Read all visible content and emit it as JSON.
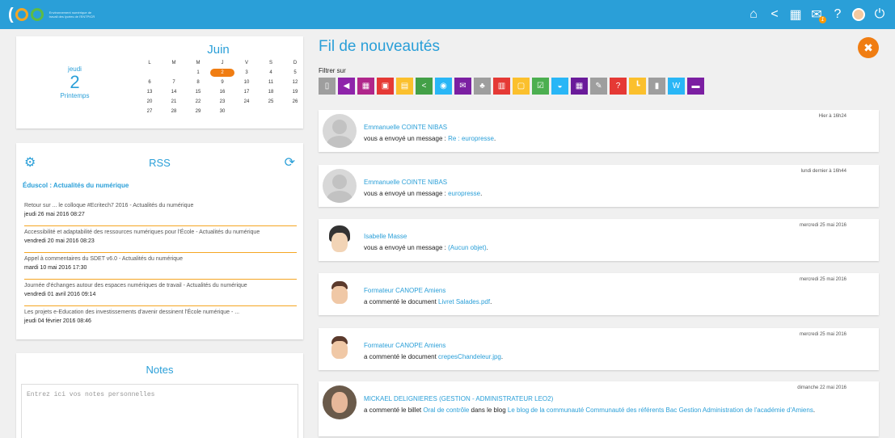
{
  "header": {
    "logo_text": "eo",
    "logo_tagline": "Environnement numérique de travail des lycées de l'ENTPICR",
    "icons": [
      "home-icon",
      "share-icon",
      "apps-icon",
      "messages-icon",
      "help-icon",
      "profile-avatar",
      "power-icon"
    ],
    "messages_badge": "1"
  },
  "calendar": {
    "weekday": "jeudi",
    "day": "2",
    "season": "Printemps",
    "month": "Juin",
    "headers": [
      "L",
      "M",
      "M",
      "J",
      "V",
      "S",
      "D"
    ],
    "days": [
      "",
      "",
      "1",
      "2",
      "3",
      "4",
      "5",
      "6",
      "7",
      "8",
      "9",
      "10",
      "11",
      "12",
      "13",
      "14",
      "15",
      "16",
      "17",
      "18",
      "19",
      "20",
      "21",
      "22",
      "23",
      "24",
      "25",
      "26",
      "27",
      "28",
      "29",
      "30"
    ],
    "today": "2"
  },
  "rss": {
    "title": "RSS",
    "source": "Éduscol : Actualités du numérique",
    "items": [
      {
        "title": "Retour sur ... le colloque #Ecritech7 2016 - Actualités du numérique",
        "date": "jeudi 26 mai 2016 08:27"
      },
      {
        "title": "Accessibilité et adaptabilité des ressources numériques pour l'École - Actualités du numérique",
        "date": "vendredi 20 mai 2016 08:23"
      },
      {
        "title": "Appel à commentaires du SDET v6.0 - Actualités du numérique",
        "date": "mardi 10 mai 2016 17:30"
      },
      {
        "title": "Journée d'échanges autour des espaces numériques de travail - Actualités du numérique",
        "date": "vendredi 01 avril 2016 09:14"
      },
      {
        "title": "Les projets e-Education des investissements d'avenir dessinent l'École numérique - ...",
        "date": "jeudi 04 février 2016 08:46"
      }
    ]
  },
  "notes": {
    "title": "Notes",
    "placeholder": "Entrez ici vos notes personnelles"
  },
  "feed": {
    "title": "Fil de nouveautés",
    "filter_label": "Filtrer sur",
    "filters": [
      {
        "name": "document-filter",
        "color": "#9e9e9e",
        "glyph": "▯"
      },
      {
        "name": "announce-filter",
        "color": "#8e24aa",
        "glyph": "◀"
      },
      {
        "name": "calendar-filter",
        "color": "#b0268b",
        "glyph": "▦"
      },
      {
        "name": "gift-filter",
        "color": "#e53935",
        "glyph": "▣"
      },
      {
        "name": "print-filter",
        "color": "#fbc02d",
        "glyph": "▤"
      },
      {
        "name": "share-filter",
        "color": "#43a047",
        "glyph": "<"
      },
      {
        "name": "chat-filter",
        "color": "#29b6f6",
        "glyph": "◉"
      },
      {
        "name": "mail-filter",
        "color": "#7b1fa2",
        "glyph": "✉"
      },
      {
        "name": "network-filter",
        "color": "#9e9e9e",
        "glyph": "♣"
      },
      {
        "name": "news-filter",
        "color": "#e53935",
        "glyph": "▥"
      },
      {
        "name": "board-filter",
        "color": "#fbc02d",
        "glyph": "▢"
      },
      {
        "name": "check-filter",
        "color": "#4caf50",
        "glyph": "☑"
      },
      {
        "name": "inbox-filter",
        "color": "#29b6f6",
        "glyph": "◒"
      },
      {
        "name": "schedule-filter",
        "color": "#6a1b9a",
        "glyph": "▦"
      },
      {
        "name": "pen-filter",
        "color": "#9e9e9e",
        "glyph": "✎"
      },
      {
        "name": "help-filter",
        "color": "#e53935",
        "glyph": "?"
      },
      {
        "name": "tree-filter",
        "color": "#fbc02d",
        "glyph": "┗"
      },
      {
        "name": "user-filter",
        "color": "#9e9e9e",
        "glyph": "▮"
      },
      {
        "name": "wiki-filter",
        "color": "#29b6f6",
        "glyph": "W"
      },
      {
        "name": "folder-filter",
        "color": "#7b1fa2",
        "glyph": "▬"
      }
    ],
    "posts": [
      {
        "avatar": "g",
        "date": "Hier à 16h24",
        "name": "Emmanuelle COINTE NIBAS",
        "text": "vous a envoyé un message : ",
        "link": "Re : europresse",
        "suffix": "."
      },
      {
        "avatar": "g",
        "date": "lundi dernier à 16h44",
        "name": "Emmanuelle COINTE NIBAS",
        "text": "vous a envoyé un message : ",
        "link": "europresse",
        "suffix": "."
      },
      {
        "avatar": "f",
        "date": "mercredi 25 mai 2016",
        "name": "Isabelle Masse",
        "text": "vous a envoyé un message : ",
        "link": "(Aucun objet)",
        "suffix": "."
      },
      {
        "avatar": "m",
        "date": "mercredi 25 mai 2016",
        "name": "Formateur CANOPE Amiens",
        "text": "a commenté le document ",
        "link": "Livret Salades.pdf",
        "suffix": "."
      },
      {
        "avatar": "m",
        "date": "mercredi 25 mai 2016",
        "name": "Formateur CANOPE Amiens",
        "text": "a commenté le document ",
        "link": "crepesChandeleur.jpg",
        "suffix": "."
      },
      {
        "avatar": "p",
        "date": "dimanche 22 mai 2016",
        "name": "MICKAEL DELIGNIERES (GESTION - ADMINISTRATEUR LEO2)",
        "text": "a commenté le billet ",
        "link": "Oral de contrôle",
        "middle": " dans le blog ",
        "link2": "Le blog de la communauté Communauté des référents Bac Gestion Administration de l'académie d'Amiens",
        "suffix": "."
      }
    ]
  }
}
